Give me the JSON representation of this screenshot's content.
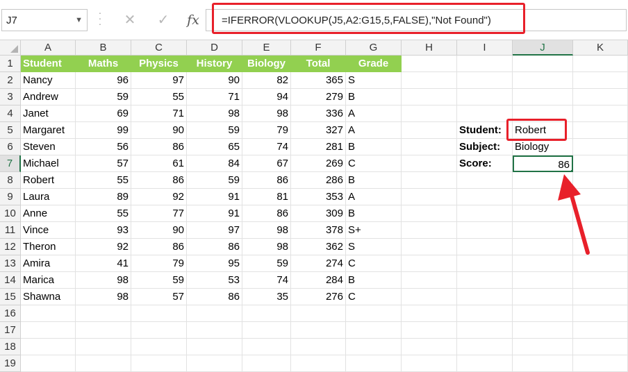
{
  "name_box": {
    "value": "J7"
  },
  "formula_bar": {
    "cancel_glyph": "✕",
    "enter_glyph": "✓",
    "fx_label": "fx",
    "formula": "=IFERROR(VLOOKUP(J5,A2:G15,5,FALSE),\"Not Found\")"
  },
  "columns": [
    "A",
    "B",
    "C",
    "D",
    "E",
    "F",
    "G",
    "H",
    "I",
    "J",
    "K"
  ],
  "rows": [
    "1",
    "2",
    "3",
    "4",
    "5",
    "6",
    "7",
    "8",
    "9",
    "10",
    "11",
    "12",
    "13",
    "14",
    "15",
    "16",
    "17",
    "18",
    "19"
  ],
  "selected_cell": "J7",
  "headers": [
    "Student",
    "Maths",
    "Physics",
    "History",
    "Biology",
    "Total",
    "Grade"
  ],
  "table": [
    [
      "Nancy",
      "96",
      "97",
      "90",
      "82",
      "365",
      "S"
    ],
    [
      "Andrew",
      "59",
      "55",
      "71",
      "94",
      "279",
      "B"
    ],
    [
      "Janet",
      "69",
      "71",
      "98",
      "98",
      "336",
      "A"
    ],
    [
      "Margaret",
      "99",
      "90",
      "59",
      "79",
      "327",
      "A"
    ],
    [
      "Steven",
      "56",
      "86",
      "65",
      "74",
      "281",
      "B"
    ],
    [
      "Michael",
      "57",
      "61",
      "84",
      "67",
      "269",
      "C"
    ],
    [
      "Robert",
      "55",
      "86",
      "59",
      "86",
      "286",
      "B"
    ],
    [
      "Laura",
      "89",
      "92",
      "91",
      "81",
      "353",
      "A"
    ],
    [
      "Anne",
      "55",
      "77",
      "91",
      "86",
      "309",
      "B"
    ],
    [
      "Vince",
      "93",
      "90",
      "97",
      "98",
      "378",
      "S+"
    ],
    [
      "Theron",
      "92",
      "86",
      "86",
      "98",
      "362",
      "S"
    ],
    [
      "Amira",
      "41",
      "79",
      "95",
      "59",
      "274",
      "C"
    ],
    [
      "Marica",
      "98",
      "59",
      "53",
      "74",
      "284",
      "B"
    ],
    [
      "Shawna",
      "98",
      "57",
      "86",
      "35",
      "276",
      "C"
    ]
  ],
  "lookup": {
    "student_label": "Student:",
    "student_value": "Robert",
    "subject_label": "Subject:",
    "subject_value": "Biology",
    "score_label": "Score:",
    "score_value": "86"
  },
  "colors": {
    "header_fill": "#92d050",
    "highlight": "#e8202a",
    "selection": "#217346"
  }
}
